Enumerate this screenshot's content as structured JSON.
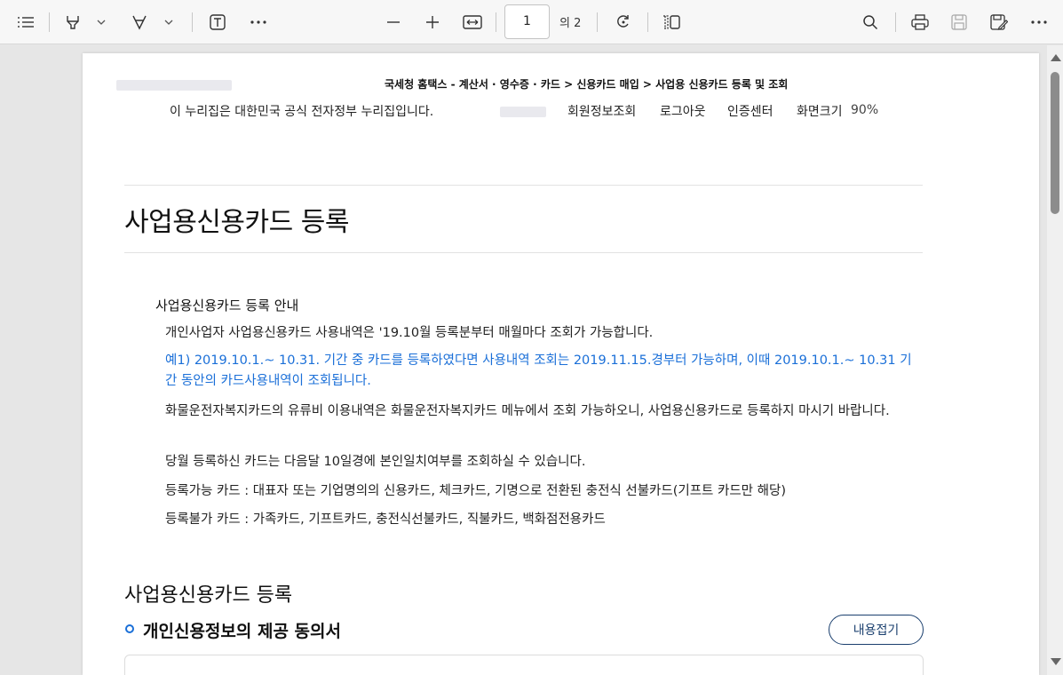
{
  "toolbar": {
    "icons": [
      "contents-list-icon",
      "highlighter-icon",
      "chevron-down-icon",
      "draw-icon",
      "chevron-down-icon",
      "add-text-icon",
      "more-horizontal-icon",
      "zoom-out-icon",
      "zoom-in-icon",
      "fit-width-icon",
      "rotate-icon",
      "two-page-view-icon",
      "search-icon",
      "print-icon",
      "save-icon",
      "save-as-icon",
      "more-options-icon"
    ],
    "page_number": "1",
    "page_total": "의 2"
  },
  "document": {
    "breadcrumb": "국세청 홈택스 - 계산서 · 영수증 · 카드 > 신용카드 매입 > 사업용 신용카드 등록 및 조회",
    "gov_notice": "이 누리집은 대한민국 공식 전자정부 누리집입니다.",
    "util_links": [
      "회원정보조회",
      "로그아웃",
      "인증센터",
      "화면크기"
    ],
    "zoom_value": "90%",
    "page_title": "사업용신용카드 등록",
    "guide_title": "사업용신용카드 등록 안내",
    "guide_paragraphs": [
      "개인사업자 사업용신용카드 사용내역은 '19.10월 등록분부터 매월마다 조회가 가능합니다.",
      "예1) 2019.10.1.~ 10.31. 기간 중 카드를 등록하였다면 사용내역 조회는 2019.11.15.경부터 가능하며, 이때 2019.10.1.~ 10.31 기간 동안의 카드사용내역이 조회됩니다.",
      "화물운전자복지카드의 유류비 이용내역은 화물운전자복지카드 메뉴에서 조회 가능하오니, 사업용신용카드로 등록하지 마시기 바랍니다.",
      "당월 등록하신 카드는 다음달 10일경에 본인일치여부를 조회하실 수 있습니다.",
      "등록가능 카드 : 대표자 또는 기업명의의 신용카드, 체크카드, 기명으로 전환된 충전식 선불카드(기프트 카드만 해당)",
      "등록불가 카드 : 가족카드, 기프트카드, 충전식선불카드, 직불카드, 백화점전용카드"
    ],
    "section_title": "사업용신용카드 등록",
    "subsection_title": "개인신용정보의 제공 동의서",
    "collapse_label": "내용접기"
  },
  "colors": {
    "accent_blue": "#1a6fd8",
    "button_border": "#1a3f6e"
  }
}
